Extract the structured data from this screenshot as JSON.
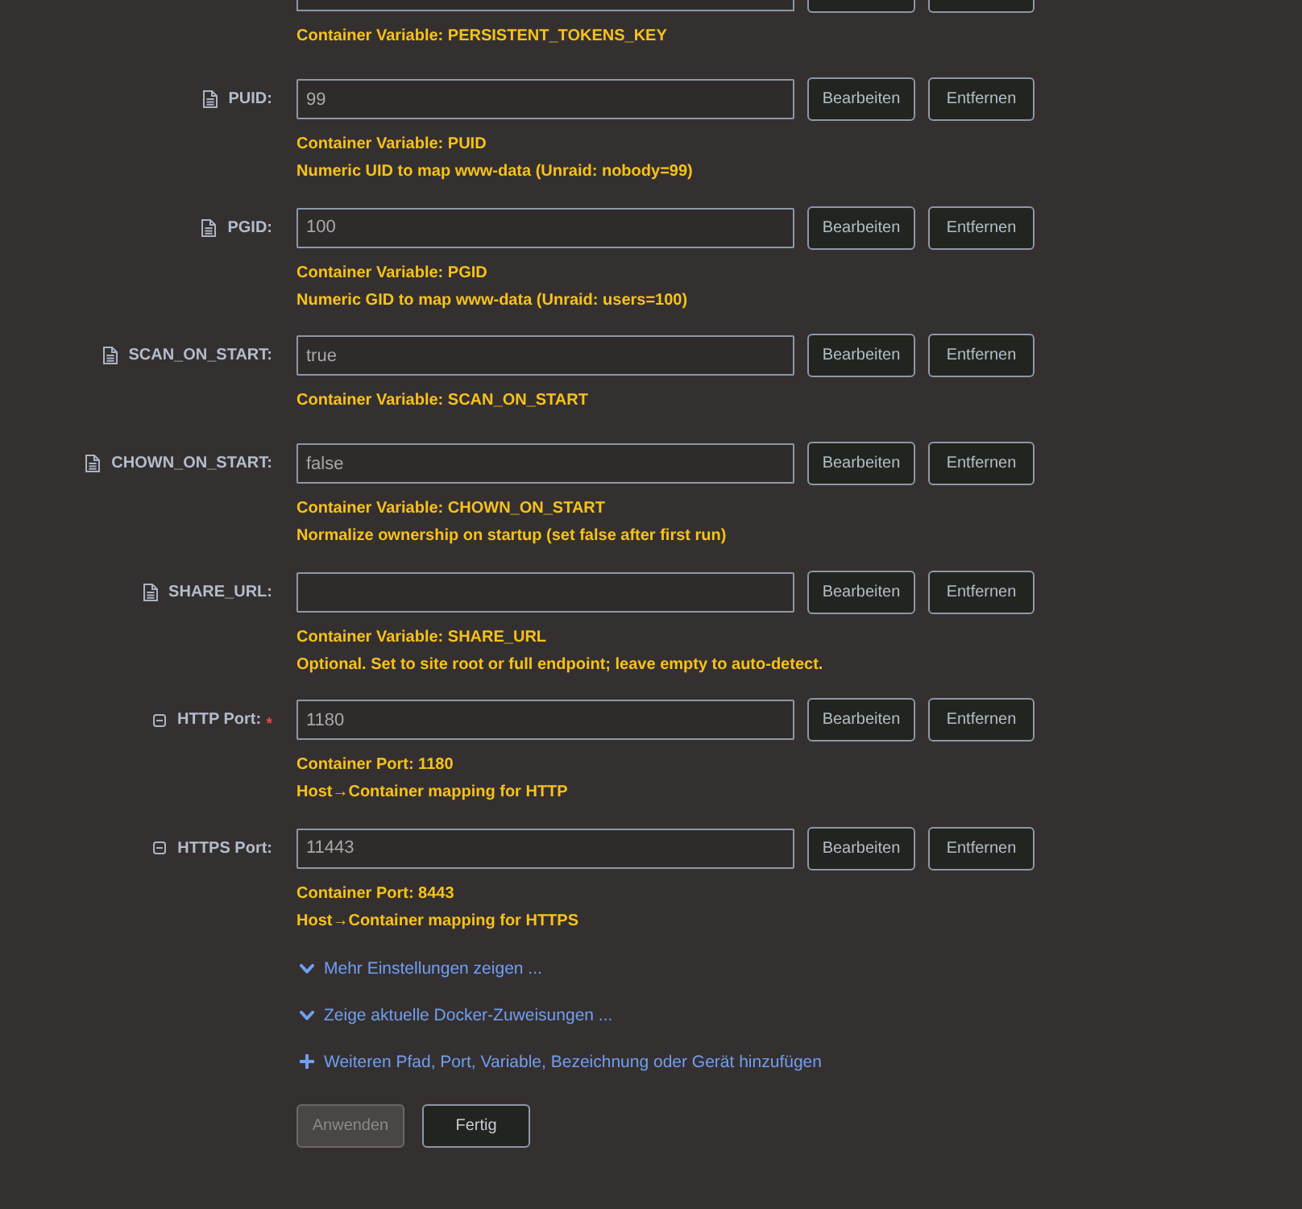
{
  "cut_off_row": {
    "descriptions": [
      "Container Variable: PERSISTENT_TOKENS_KEY"
    ]
  },
  "fields": [
    {
      "kind": "variable",
      "label": "PUID:",
      "value": "99",
      "buttons": [
        {
          "kind": "edit",
          "label": "Bearbeiten"
        },
        {
          "kind": "remove",
          "label": "Entfernen"
        }
      ],
      "descriptions": [
        "Container Variable: PUID",
        "Numeric UID to map www-data (Unraid: nobody=99)"
      ]
    },
    {
      "kind": "variable",
      "label": "PGID:",
      "value": "100",
      "buttons": [
        {
          "kind": "edit",
          "label": "Bearbeiten"
        },
        {
          "kind": "remove",
          "label": "Entfernen"
        }
      ],
      "descriptions": [
        "Container Variable: PGID",
        "Numeric GID to map www-data (Unraid: users=100)"
      ]
    },
    {
      "kind": "variable",
      "label": "SCAN_ON_START:",
      "value": "true",
      "buttons": [
        {
          "kind": "edit",
          "label": "Bearbeiten"
        },
        {
          "kind": "remove",
          "label": "Entfernen"
        }
      ],
      "descriptions": [
        "Container Variable: SCAN_ON_START"
      ]
    },
    {
      "kind": "variable",
      "label": "CHOWN_ON_START:",
      "value": "false",
      "buttons": [
        {
          "kind": "edit",
          "label": "Bearbeiten"
        },
        {
          "kind": "remove",
          "label": "Entfernen"
        }
      ],
      "descriptions": [
        "Container Variable: CHOWN_ON_START",
        "Normalize ownership on startup (set false after first run)"
      ]
    },
    {
      "kind": "variable",
      "label": "SHARE_URL:",
      "buttons": [
        {
          "kind": "edit",
          "label": "Bearbeiten"
        },
        {
          "kind": "remove",
          "label": "Entfernen"
        }
      ],
      "descriptions": [
        "Container Variable: SHARE_URL",
        "Optional. Set to site root or full endpoint; leave empty to auto-detect."
      ]
    },
    {
      "kind": "port",
      "label": "HTTP Port:",
      "required_mark": "*",
      "value": "1180",
      "buttons": [
        {
          "kind": "edit",
          "label": "Bearbeiten"
        },
        {
          "kind": "remove",
          "label": "Entfernen"
        }
      ],
      "descriptions": [
        "Container Port: 1180",
        "Host→Container mapping for HTTP"
      ]
    },
    {
      "kind": "port",
      "label": "HTTPS Port:",
      "value": "11443",
      "buttons": [
        {
          "kind": "edit",
          "label": "Bearbeiten"
        },
        {
          "kind": "remove",
          "label": "Entfernen"
        }
      ],
      "descriptions": [
        "Container Port: 8443",
        "Host→Container mapping for HTTPS"
      ]
    }
  ],
  "links": [
    {
      "kind": "expand",
      "text": "Mehr Einstellungen zeigen ..."
    },
    {
      "kind": "expand",
      "text": "Zeige aktuelle Docker-Zuweisungen ..."
    },
    {
      "kind": "add",
      "text": "Weiteren Pfad, Port, Variable, Bezeichnung oder Gerät hinzufügen"
    }
  ],
  "actions": [
    {
      "label": "Anwenden",
      "disabled": true
    },
    {
      "label": "Fertig",
      "disabled": false
    }
  ]
}
